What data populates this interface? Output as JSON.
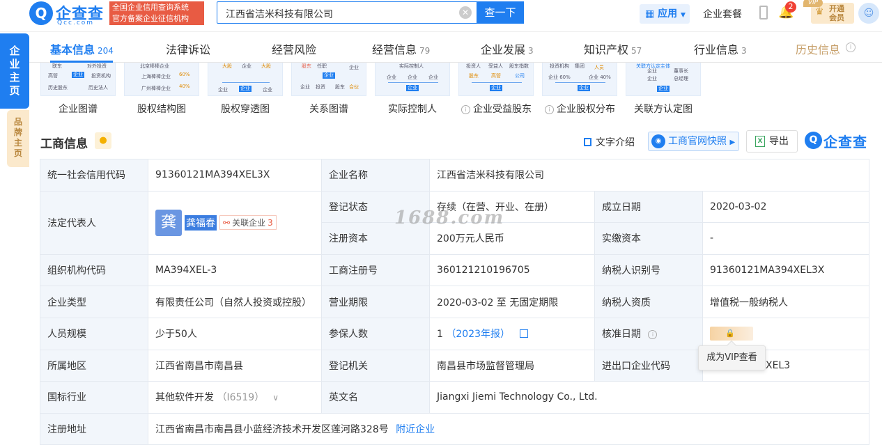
{
  "header": {
    "logo_cn": "企查查",
    "logo_en": "Qcc.com",
    "badge_line1": "全国企业信用查询系统",
    "badge_line2": "官方备案企业征信机构",
    "search_value": "江西省洁米科技有限公司",
    "search_button": "查一下",
    "apps_label": "应用",
    "suite_label": "企业套餐",
    "notification_count": "2",
    "vip_line1": "开通",
    "vip_line2": "会员"
  },
  "side": {
    "main_label": "企业主页",
    "brand_label": "品牌主页"
  },
  "tabs": [
    {
      "label": "基本信息",
      "count": "204"
    },
    {
      "label": "法律诉讼",
      "count": ""
    },
    {
      "label": "经营风险",
      "count": ""
    },
    {
      "label": "经营信息",
      "count": "79"
    },
    {
      "label": "企业发展",
      "count": "3"
    },
    {
      "label": "知识产权",
      "count": "57"
    },
    {
      "label": "行业信息",
      "count": "3"
    },
    {
      "label": "历史信息",
      "count": ""
    }
  ],
  "vip_tag": "VIP",
  "graphs": [
    {
      "label": "企业图谱",
      "info": false
    },
    {
      "label": "股权结构图",
      "info": false
    },
    {
      "label": "股权穿透图",
      "info": false
    },
    {
      "label": "关系图谱",
      "info": false
    },
    {
      "label": "实际控制人",
      "info": false
    },
    {
      "label": "企业受益股东",
      "info": true
    },
    {
      "label": "企业股权分布",
      "info": true
    },
    {
      "label": "关联方认定图",
      "info": false
    }
  ],
  "thumb_text": {
    "t1": [
      "联东",
      "对外投资",
      "高管",
      "企业",
      "投资机构",
      "历史股东",
      "历史法人"
    ],
    "t2": [
      "北京棒棒企业",
      "上海棒棒企业",
      "广州棒棒企业",
      "60%",
      "40%"
    ],
    "t3": [
      "大股",
      "企业",
      "大股",
      "企业",
      "企业",
      "企业"
    ],
    "t4": [
      "股东",
      "任职",
      "企业",
      "任职",
      "企业",
      "投资",
      "股东",
      "合伙"
    ],
    "t5": [
      "实际控制人",
      "企业",
      "企业",
      "企业",
      "企业"
    ],
    "t6": [
      "投资人",
      "受益人",
      "股东指数",
      "股东",
      "高管",
      "公司",
      "企业"
    ],
    "t7": [
      "投资机构",
      "集团",
      "人员",
      "企业 60%",
      "企业 40%",
      "企业"
    ],
    "t8": [
      "关联方认定主体",
      "企业",
      "董事长",
      "企业",
      "总经理",
      "企业"
    ]
  },
  "section": {
    "title": "工商信息",
    "text_intro": "文字介绍",
    "snapshot": "工商官网快照",
    "export": "导出",
    "brand": "企查查"
  },
  "table": {
    "credit_code_label": "统一社会信用代码",
    "credit_code": "91360121MA394XEL3X",
    "company_name_label": "企业名称",
    "company_name": "江西省洁米科技有限公司",
    "legal_rep_label": "法定代表人",
    "legal_rep_avatar": "龚",
    "legal_rep_name": "龚福春",
    "related_label": "关联企业",
    "related_count": "3",
    "reg_status_label": "登记状态",
    "reg_status": "存续（在营、开业、在册）",
    "founded_label": "成立日期",
    "founded": "2020-03-02",
    "reg_capital_label": "注册资本",
    "reg_capital": "200万元人民币",
    "paid_capital_label": "实缴资本",
    "paid_capital": "-",
    "org_code_label": "组织机构代码",
    "org_code": "MA394XEL-3",
    "biz_reg_no_label": "工商注册号",
    "biz_reg_no": "360121210196705",
    "taxpayer_id_label": "纳税人识别号",
    "taxpayer_id": "91360121MA394XEL3X",
    "company_type_label": "企业类型",
    "company_type": "有限责任公司（自然人投资或控股）",
    "biz_term_label": "营业期限",
    "biz_term": "2020-03-02 至 无固定期限",
    "taxpayer_qual_label": "纳税人资质",
    "taxpayer_qual": "增值税一般纳税人",
    "staff_label": "人员规模",
    "staff": "少于50人",
    "insured_label": "参保人数",
    "insured": "1",
    "insured_year": "（2023年报）",
    "approval_label": "核准日期",
    "region_label": "所属地区",
    "region": "江西省南昌市南昌县",
    "authority_label": "登记机关",
    "authority": "南昌县市场监督管理局",
    "import_export_label": "进出口企业代码",
    "import_export": "XEL3",
    "industry_label": "国标行业",
    "industry": "其他软件开发",
    "industry_code": "（I6519）",
    "english_name_label": "英文名",
    "english_name": "Jiangxi Jiemi Technology Co., Ltd.",
    "address_label": "注册地址",
    "address": "江西省南昌市南昌县小蓝经济技术开发区莲河路328号",
    "nearby": "附近企业"
  },
  "tooltip": "成为VIP查看",
  "watermark": "1688.com",
  "colors": {
    "primary": "#1f7ef0",
    "badge_red": "#e85b43",
    "vip_gold": "#c7a06b"
  }
}
